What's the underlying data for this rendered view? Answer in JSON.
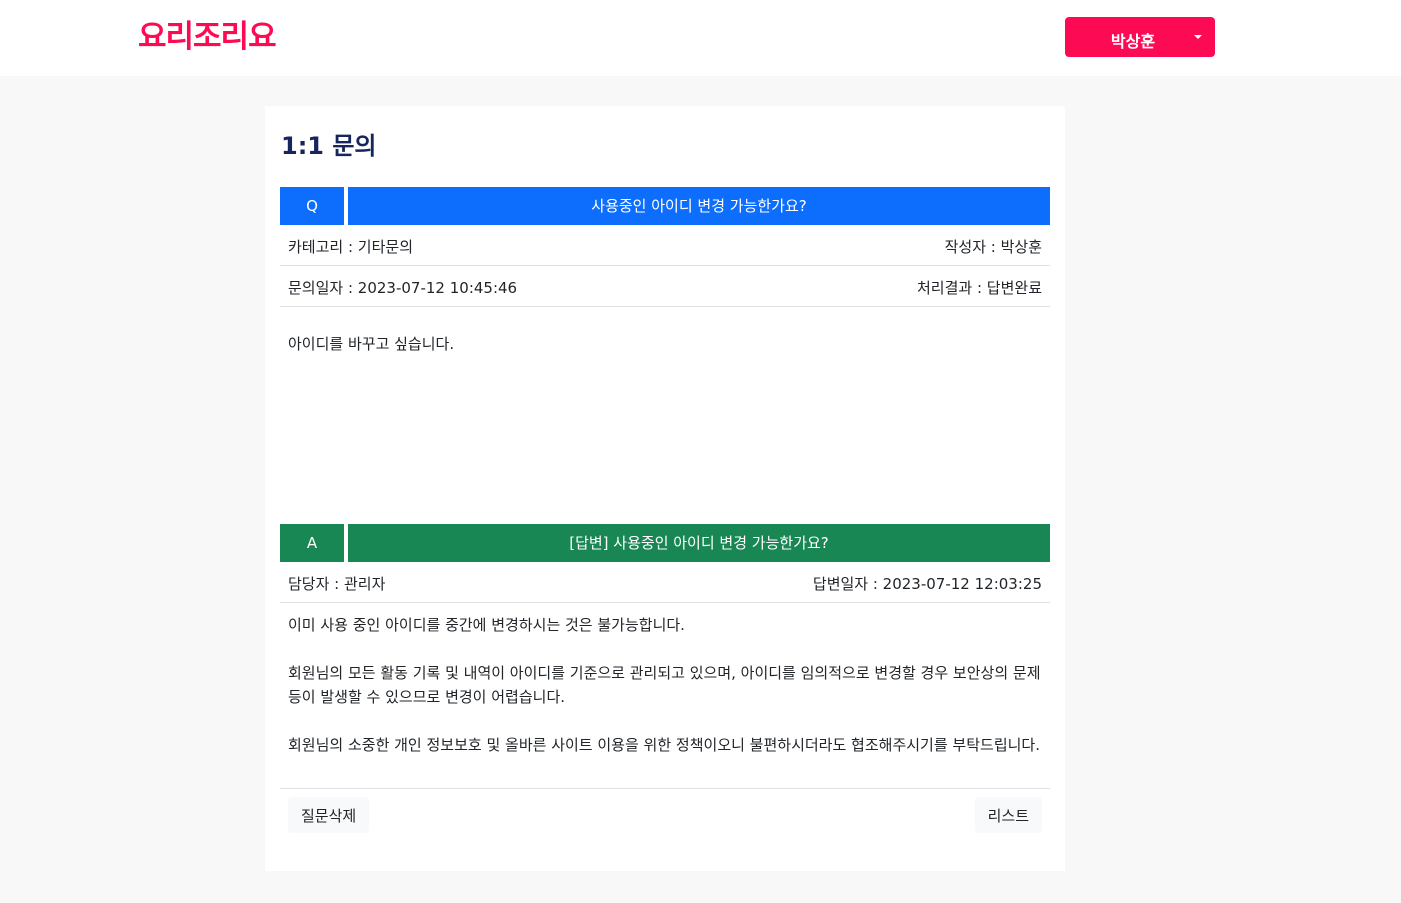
{
  "header": {
    "logo": "요리조리요",
    "user_name": "박상훈",
    "brand_color": "#fd0a54"
  },
  "page": {
    "title": "1:1 문의"
  },
  "question": {
    "tag": "Q",
    "subject": "사용중인 아이디 변경 가능한가요?",
    "category": "카테고리 : 기타문의",
    "author": "작성자 : 박상훈",
    "date": "문의일자 : 2023-07-12 10:45:46",
    "status": "처리결과 : 답변완료",
    "body": "아이디를 바꾸고 싶습니다.",
    "color": "#0d6efd"
  },
  "answer": {
    "tag": "A",
    "subject": "[답변] 사용중인 아이디 변경 가능한가요?",
    "manager": "담당자 : 관리자",
    "date": "답변일자 : 2023-07-12 12:03:25",
    "paragraphs": [
      "이미 사용 중인 아이디를 중간에 변경하시는 것은 불가능합니다.",
      "회원님의 모든 활동 기록 및 내역이 아이디를 기준으로 관리되고 있으며, 아이디를 임의적으로 변경할 경우 보안상의 문제 등이 발생할 수 있으므로 변경이 어렵습니다.",
      "회원님의 소중한 개인 정보보호 및 올바른 사이트 이용을 위한 정책이오니 불편하시더라도 협조해주시기를 부탁드립니다."
    ],
    "color": "#198754"
  },
  "actions": {
    "delete_label": "질문삭제",
    "list_label": "리스트"
  }
}
